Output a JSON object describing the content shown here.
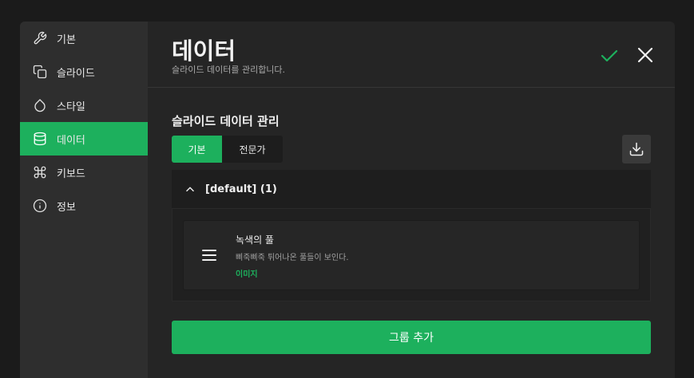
{
  "sidebar": {
    "items": [
      {
        "label": "기본",
        "icon": "wrench-icon"
      },
      {
        "label": "슬라이드",
        "icon": "copy-icon"
      },
      {
        "label": "스타일",
        "icon": "droplet-icon"
      },
      {
        "label": "데이터",
        "icon": "database-icon",
        "active": true
      },
      {
        "label": "키보드",
        "icon": "command-icon"
      },
      {
        "label": "정보",
        "icon": "info-icon"
      }
    ]
  },
  "header": {
    "title": "데이터",
    "subtitle": "슬라이드 데이터를 관리합니다."
  },
  "section": {
    "title": "슬라이드 데이터 관리",
    "tabs": [
      "기본",
      "전문가"
    ]
  },
  "group": {
    "name": "[default] (1)",
    "items": [
      {
        "title": "녹색의 풀",
        "description": "삐죽삐죽 튀어나온 풀들이 보인다.",
        "type": "이미지"
      }
    ]
  },
  "add_button": "그룹 추가",
  "colors": {
    "accent": "#1db05d",
    "sidebar": "#2e2e2e",
    "panel": "#252525",
    "background": "#1b1b1b"
  }
}
